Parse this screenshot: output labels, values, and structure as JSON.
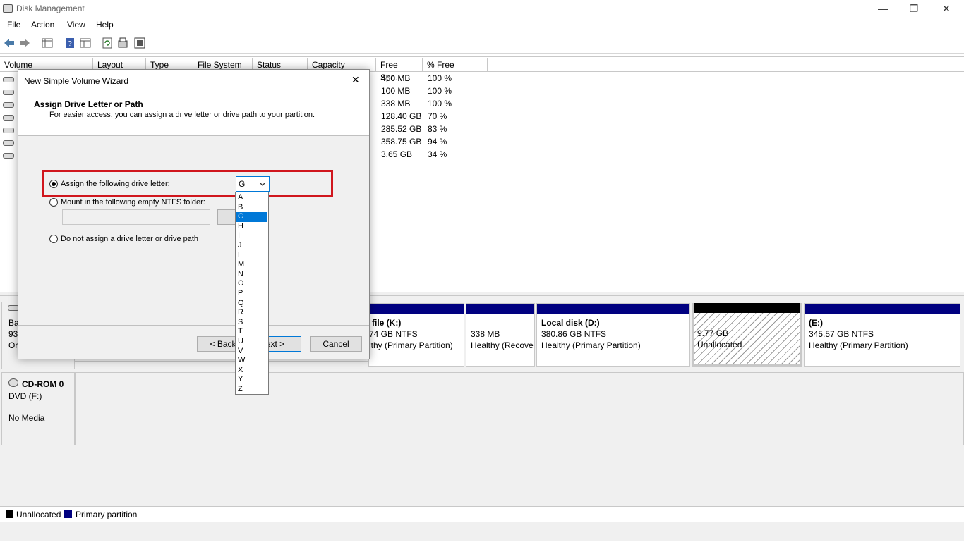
{
  "window": {
    "title": "Disk Management",
    "minimize": "—",
    "restore": "❐",
    "close": "✕"
  },
  "menu": [
    "File",
    "Action",
    "View",
    "Help"
  ],
  "columns": [
    "Volume",
    "Layout",
    "Type",
    "File System",
    "Status",
    "Capacity",
    "Free Spa...",
    "% Free"
  ],
  "rows": [
    {
      "free": "450 MB",
      "pct": "100 %"
    },
    {
      "free": "100 MB",
      "pct": "100 %"
    },
    {
      "free": "338 MB",
      "pct": "100 %"
    },
    {
      "free": "128.40 GB",
      "pct": "70 %"
    },
    {
      "free": "285.52 GB",
      "pct": "83 %"
    },
    {
      "free": "358.75 GB",
      "pct": "94 %"
    },
    {
      "free": "3.65 GB",
      "pct": "34 %"
    }
  ],
  "disk0": {
    "l1": "Ba",
    "l2": "93",
    "l3": "Or"
  },
  "partitions": [
    {
      "name": "file  (K:)",
      "size": "74 GB NTFS",
      "status": "lthy (Primary Partition)"
    },
    {
      "name": "",
      "size": "338 MB",
      "status": "Healthy (Recove"
    },
    {
      "name": "Local disk  (D:)",
      "size": "380.86 GB NTFS",
      "status": "Healthy (Primary Partition)"
    },
    {
      "name": "",
      "size": "9.77 GB",
      "status": "Unallocated"
    },
    {
      "name": "(E:)",
      "size": "345.57 GB NTFS",
      "status": "Healthy (Primary Partition)"
    }
  ],
  "cdrom": {
    "name": "CD-ROM 0",
    "type": "DVD (F:)",
    "media": "No Media"
  },
  "legend": {
    "unallocated": "Unallocated",
    "primary": "Primary partition"
  },
  "colors": {
    "primary": "#000080",
    "unallocated": "#000000",
    "highlight": "#d0161d",
    "selection": "#0078d7"
  },
  "dialog": {
    "title": "New Simple Volume Wizard",
    "close": "✕",
    "heading": "Assign Drive Letter or Path",
    "subheading": "For easier access, you can assign a drive letter or drive path to your partition.",
    "opt1": "Assign the following drive letter:",
    "opt2": "Mount in the following empty NTFS folder:",
    "opt3": "Do not assign a drive letter or drive path",
    "browse": "Br",
    "selected_letter": "G",
    "back": "< Back",
    "next": "ext >",
    "cancel": "Cancel",
    "letters": [
      "A",
      "B",
      "G",
      "H",
      "I",
      "J",
      "L",
      "M",
      "N",
      "O",
      "P",
      "Q",
      "R",
      "S",
      "T",
      "U",
      "V",
      "W",
      "X",
      "Y",
      "Z"
    ]
  }
}
